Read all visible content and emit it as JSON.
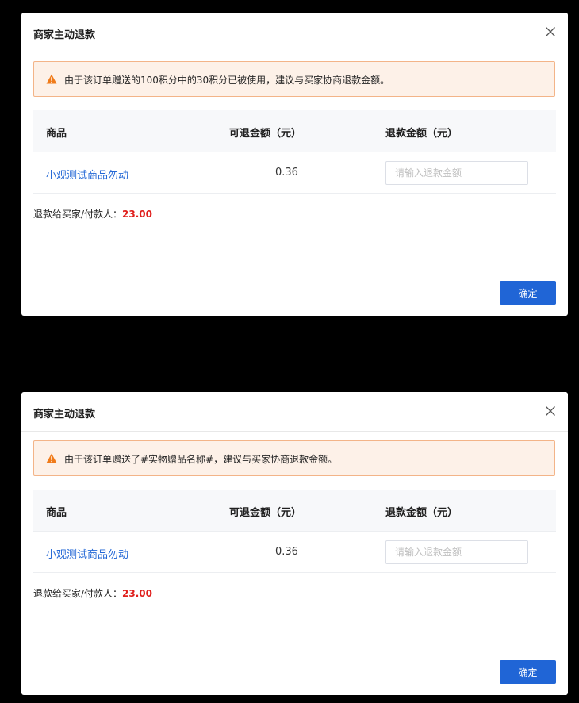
{
  "dialogs": [
    {
      "title": "商家主动退款",
      "alert": "由于该订单赠送的100积分中的30积分已被使用，建议与买家协商退款金额。",
      "table": {
        "headers": [
          "商品",
          "可退金额（元）",
          "退款金额（元）"
        ],
        "rows": [
          {
            "product": "小观测试商品勿动",
            "refundable": "0.36",
            "placeholder": "请输入退款金额"
          }
        ]
      },
      "payer_label": "退款给买家/付款人：",
      "payer_amount": "23.00",
      "confirm_label": "确定"
    },
    {
      "title": "商家主动退款",
      "alert": "由于该订单赠送了#实物赠品名称#，建议与买家协商退款金额。",
      "table": {
        "headers": [
          "商品",
          "可退金额（元）",
          "退款金额（元）"
        ],
        "rows": [
          {
            "product": "小观测试商品勿动",
            "refundable": "0.36",
            "placeholder": "请输入退款金额"
          }
        ]
      },
      "payer_label": "退款给买家/付款人：",
      "payer_amount": "23.00",
      "confirm_label": "确定"
    }
  ],
  "colors": {
    "accent": "#2065d6",
    "link": "#2468d6",
    "amount_red": "#e0201d",
    "alert_bg": "#fdf1e8",
    "alert_border": "#f3b488",
    "warning_icon": "#f07b1a"
  },
  "icons": {
    "close": "close-icon",
    "warning": "warning-icon"
  }
}
